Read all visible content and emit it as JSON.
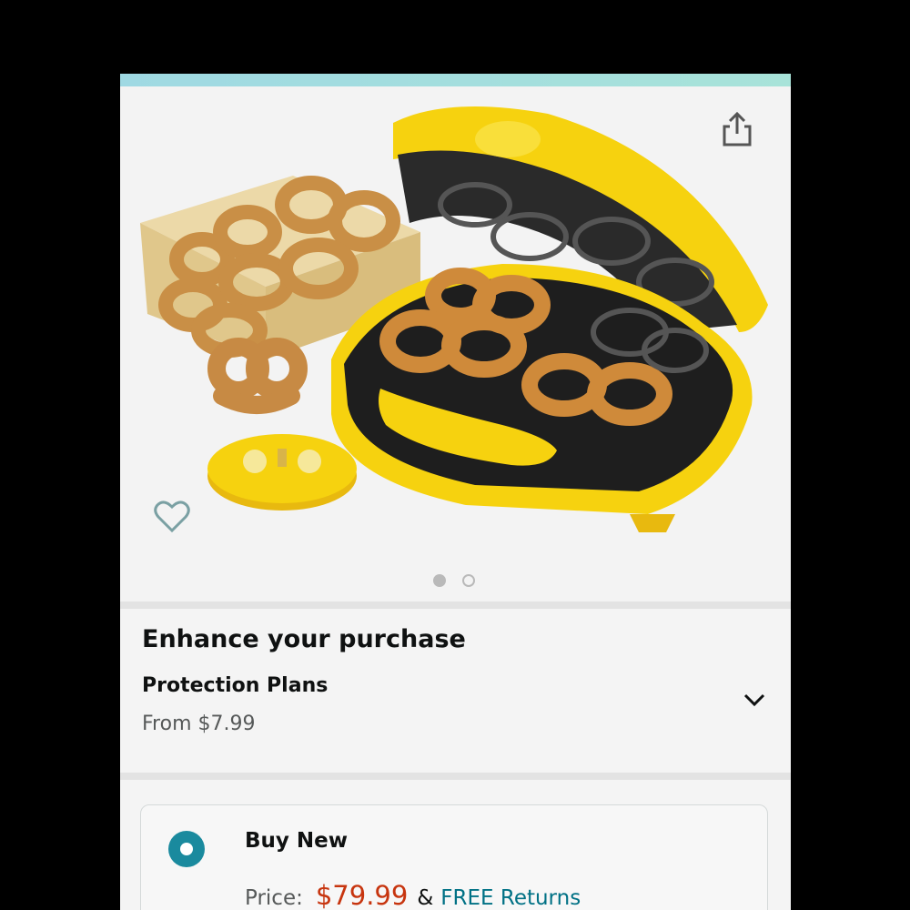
{
  "gallery": {
    "dots": [
      {
        "active": true
      },
      {
        "active": false
      }
    ],
    "icons": {
      "share": "share-icon",
      "wishlist": "heart-icon"
    }
  },
  "enhance": {
    "title": "Enhance your purchase",
    "plan_title": "Protection Plans",
    "plan_price": "From $7.99",
    "expand_icon": "chevron-down-icon"
  },
  "buy_box": {
    "option_label": "Buy New",
    "price_label": "Price:",
    "price": "$79.99",
    "amp": "&",
    "returns": "FREE Returns"
  },
  "colors": {
    "accent": "#1a8a9e",
    "price": "#c7350f",
    "link": "#007185",
    "appliance_yellow": "#f6d20f"
  }
}
